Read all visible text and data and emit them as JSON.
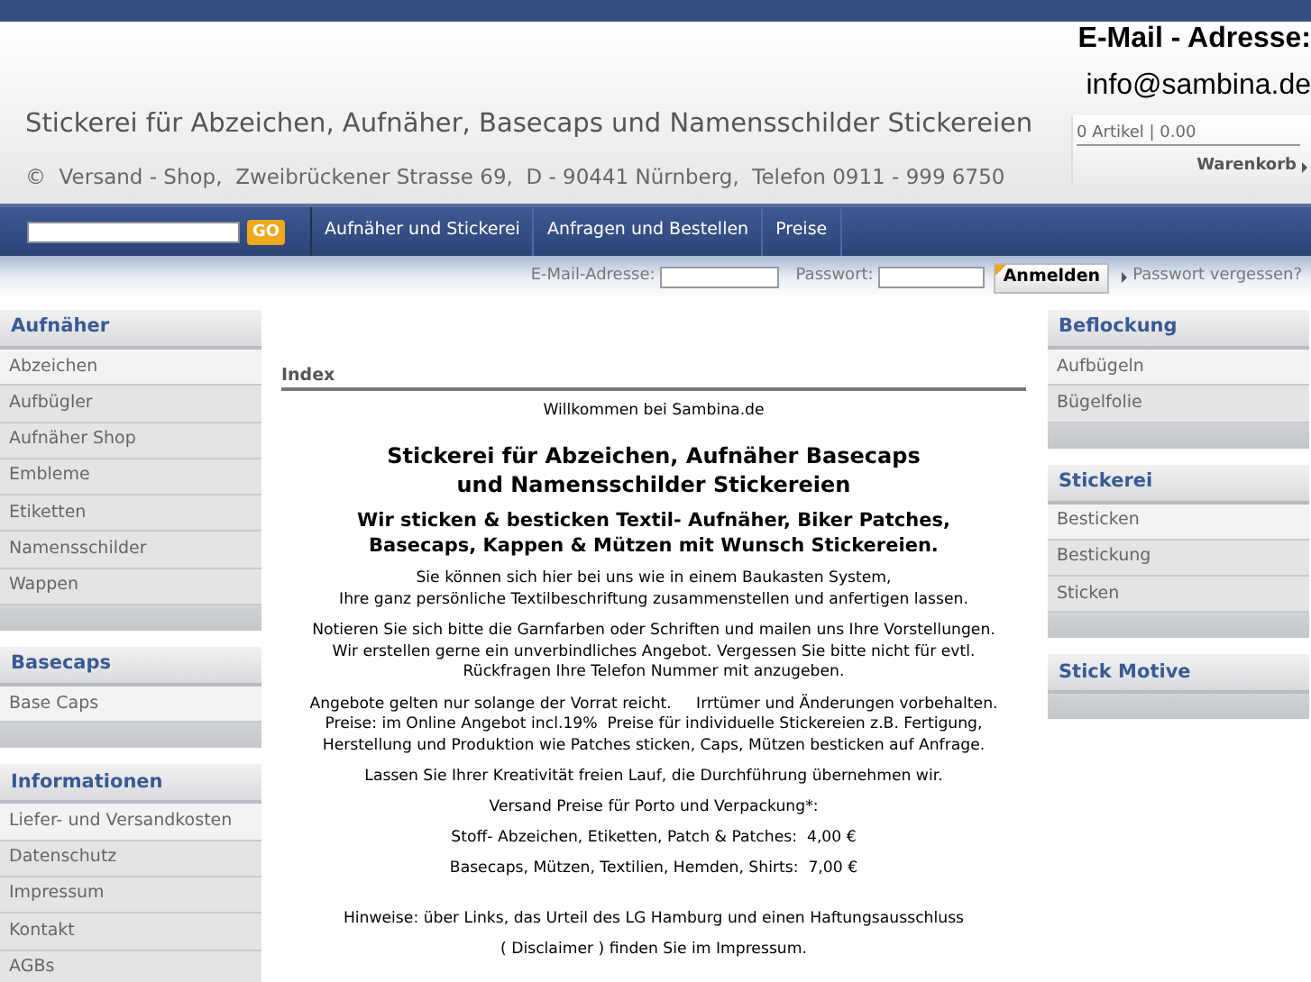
{
  "header": {
    "title": "Stickerei für Abzeichen, Aufnäher, Basecaps und Namensschilder Stickereien",
    "address": "©  Versand - Shop,  Zweibrückener Strasse 69,  D - 90441 Nürnberg,  Telefon 0911 - 999 6750",
    "email_label": "E-Mail - Adresse:",
    "email": "info@sambina.de",
    "cart_summary": "0 Artikel | 0.00",
    "cart_link": "Warenkorb"
  },
  "nav": {
    "search_button": "GO",
    "items": [
      {
        "label": "Aufnäher und Stickerei"
      },
      {
        "label": "Anfragen und Bestellen"
      },
      {
        "label": "Preise"
      }
    ]
  },
  "login": {
    "email_label": "E-Mail-Adresse:",
    "password_label": "Passwort:",
    "button": "Anmelden",
    "forgot_link": "Passwort vergessen?"
  },
  "left_sidebar": [
    {
      "title": "Aufnäher",
      "items": [
        {
          "label": "Abzeichen",
          "selected": true
        },
        {
          "label": "Aufbügler",
          "selected": false
        },
        {
          "label": "Aufnäher Shop",
          "selected": false
        },
        {
          "label": "Embleme",
          "selected": false
        },
        {
          "label": "Etiketten",
          "selected": false
        },
        {
          "label": "Namensschilder",
          "selected": false
        },
        {
          "label": "Wappen",
          "selected": false
        }
      ]
    },
    {
      "title": "Basecaps",
      "items": [
        {
          "label": "Base Caps",
          "selected": true
        }
      ]
    },
    {
      "title": "Informationen",
      "items": [
        {
          "label": "Liefer- und Versandkosten",
          "selected": true
        },
        {
          "label": "Datenschutz",
          "selected": false
        },
        {
          "label": "Impressum",
          "selected": false
        },
        {
          "label": "Kontakt",
          "selected": false
        },
        {
          "label": "AGBs",
          "selected": false
        }
      ]
    }
  ],
  "content": {
    "breadcrumb": "Index",
    "blocks": [
      {
        "kind": "text",
        "text": "Willkommen bei Sambina.de"
      },
      {
        "kind": "heading",
        "lines": [
          "Stickerei für Abzeichen, Aufnäher Basecaps",
          "und Namensschilder Stickereien"
        ]
      },
      {
        "kind": "subheading",
        "lines": [
          "Wir sticken & besticken Textil- Aufnäher, Biker Patches,",
          "Basecaps, Kappen & Mützen mit Wunsch Stickereien."
        ]
      },
      {
        "kind": "paragraph",
        "lines": [
          "Sie können sich hier bei uns wie in einem Baukasten System,",
          "Ihre ganz persönliche Textilbeschriftung zusammenstellen und anfertigen lassen."
        ]
      },
      {
        "kind": "paragraph",
        "lines": [
          "Notieren Sie sich bitte die Garnfarben oder Schriften und mailen uns Ihre Vorstellungen.",
          "Wir erstellen gerne ein unverbindliches Angebot. Vergessen Sie bitte nicht für evtl.",
          "Rückfragen Ihre Telefon Nummer mit anzugeben."
        ]
      },
      {
        "kind": "paragraph",
        "lines": [
          "Angebote gelten nur solange der Vorrat reicht.     Irrtümer und Änderungen vorbehalten.",
          "Preise: im Online Angebot incl.19%  Preise für individuelle Stickereien z.B. Fertigung,",
          "Herstellung und Produktion wie Patches sticken, Caps, Mützen besticken auf Anfrage."
        ]
      },
      {
        "kind": "text",
        "text": "Lassen Sie Ihrer Kreativität freien Lauf, die Durchführung übernehmen wir."
      },
      {
        "kind": "text",
        "text": "Versand Preise für Porto und Verpackung*:"
      },
      {
        "kind": "text",
        "text": "Stoff- Abzeichen, Etiketten, Patch & Patches:  4,00 €"
      },
      {
        "kind": "text",
        "text": "Basecaps, Mützen, Textilien, Hemden, Shirts:  7,00 €"
      },
      {
        "kind": "spacer"
      },
      {
        "kind": "text",
        "text": "Hinweise: über Links, das Urteil des LG Hamburg und einen Haftungsausschluss"
      },
      {
        "kind": "text",
        "text": "( Disclaimer ) finden Sie im Impressum."
      }
    ]
  },
  "right_sidebar": [
    {
      "title": "Beflockung",
      "items": [
        {
          "label": "Aufbügeln",
          "selected": true
        },
        {
          "label": "Bügelfolie",
          "selected": false
        }
      ]
    },
    {
      "title": "Stickerei",
      "items": [
        {
          "label": "Besticken",
          "selected": true
        },
        {
          "label": "Bestickung",
          "selected": false
        },
        {
          "label": "Sticken",
          "selected": false
        }
      ]
    },
    {
      "title": "Stick Motive"
    }
  ]
}
